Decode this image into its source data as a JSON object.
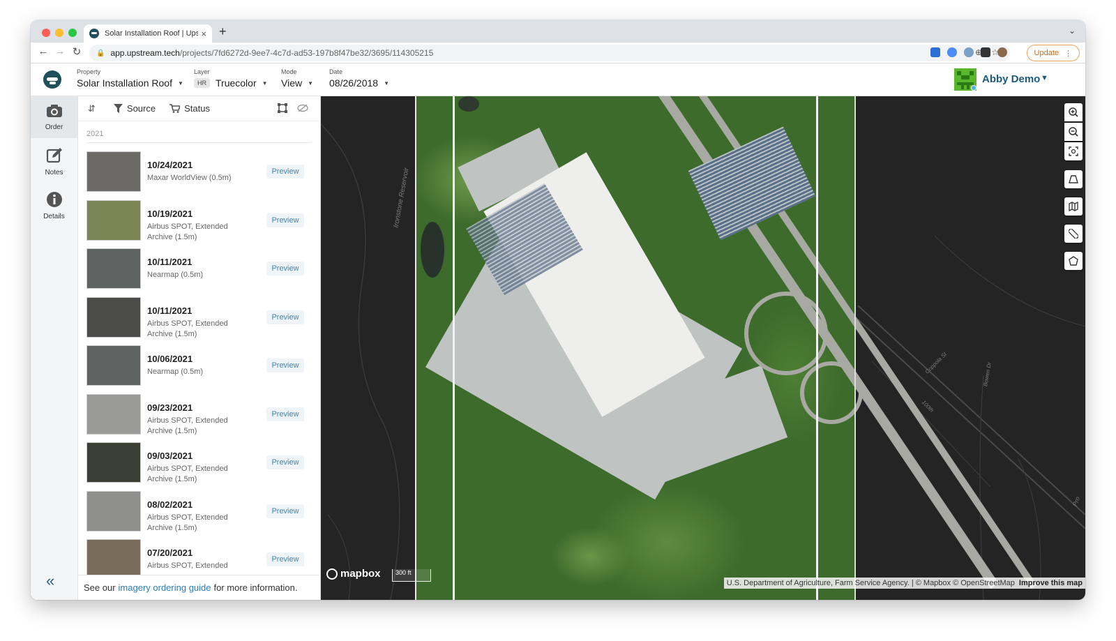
{
  "browser": {
    "tab_title": "Solar Installation Roof | Upstre...",
    "tab_close": "×",
    "new_tab": "+",
    "url_host": "app.upstream.tech",
    "url_path": "/projects/7fd6272d-9ee7-4c7d-ad53-197b8f47be32/3695/114305215",
    "update_label": "Update",
    "update_menu": "⋮"
  },
  "header": {
    "property_label": "Property",
    "property_value": "Solar Installation Roof",
    "layer_label": "Layer",
    "layer_chip": "HR",
    "layer_value": "Truecolor",
    "mode_label": "Mode",
    "mode_value": "View",
    "date_label": "Date",
    "date_value": "08/26/2018",
    "user_name": "Abby Demo"
  },
  "rail": {
    "items": [
      {
        "label": "Order",
        "icon": "camera-icon"
      },
      {
        "label": "Notes",
        "icon": "edit-icon"
      },
      {
        "label": "Details",
        "icon": "info-icon"
      }
    ],
    "collapse": "«"
  },
  "panel": {
    "tools": {
      "sort": "⇵",
      "source": "Source",
      "status": "Status"
    },
    "year": "2021",
    "items": [
      {
        "date": "10/24/2021",
        "source": "Maxar WorldView",
        "resolution": "(0.5m)",
        "action": "Preview",
        "thumb": "#6b6a66"
      },
      {
        "date": "10/19/2021",
        "source": "Airbus SPOT, Extended Archive",
        "resolution": "(1.5m)",
        "action": "Preview",
        "thumb": "#7b8556"
      },
      {
        "date": "10/11/2021",
        "source": "Nearmap",
        "resolution": "(0.5m)",
        "action": "Preview",
        "thumb": "#5f6463"
      },
      {
        "date": "10/11/2021",
        "source": "Airbus SPOT, Extended Archive",
        "resolution": "(1.5m)",
        "action": "Preview",
        "thumb": "#4b4b49"
      },
      {
        "date": "10/06/2021",
        "source": "Nearmap",
        "resolution": "(0.5m)",
        "action": "Preview",
        "thumb": "#5f6463"
      },
      {
        "date": "09/23/2021",
        "source": "Airbus SPOT, Extended Archive",
        "resolution": "(1.5m)",
        "action": "Preview",
        "thumb": "#9a9a98"
      },
      {
        "date": "09/03/2021",
        "source": "Airbus SPOT, Extended Archive",
        "resolution": "(1.5m)",
        "action": "Preview",
        "thumb": "#3b3f33"
      },
      {
        "date": "08/02/2021",
        "source": "Airbus SPOT, Extended Archive",
        "resolution": "(1.5m)",
        "action": "Preview",
        "thumb": "#8f8f8d"
      },
      {
        "date": "07/20/2021",
        "source": "Airbus SPOT, Extended",
        "resolution": "",
        "action": "Preview",
        "thumb": "#7a6c5a"
      }
    ],
    "footer_prefix": "See our",
    "footer_link": "imagery ordering guide",
    "footer_suffix": "for more information."
  },
  "map": {
    "label_reservoir": "Ironstone Reservoir",
    "label_coppola": "Coppola St",
    "label_bowen": "Bowen Dr",
    "label_road": "100th",
    "label_pr": "Pro",
    "mapbox": "mapbox",
    "scale": "300 ft",
    "attribution": "U.S. Department of Agriculture, Farm Service Agency. | © Mapbox © OpenStreetMap",
    "improve": "Improve this map"
  }
}
